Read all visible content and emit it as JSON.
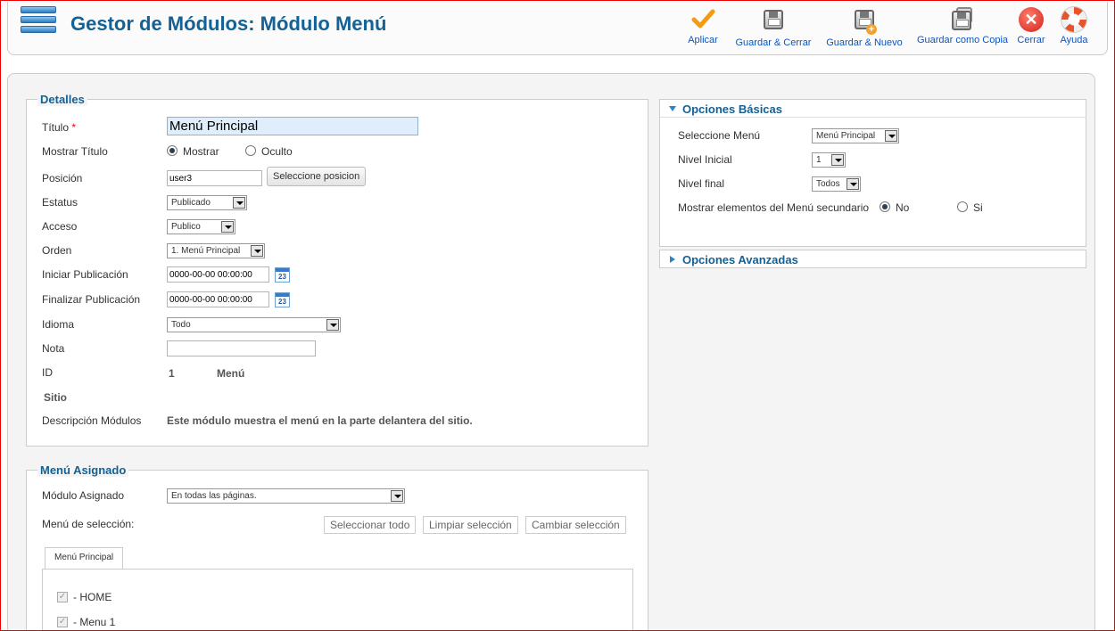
{
  "header": {
    "title": "Gestor de Módulos: Módulo Menú",
    "buttons": {
      "apply": "Aplicar",
      "save_close": "Guardar & Cerrar",
      "save_new": "Guardar & Nuevo",
      "save_copy": "Guardar como Copia",
      "close": "Cerrar",
      "help": "Ayuda"
    }
  },
  "details": {
    "legend": "Detalles",
    "title_label": "Título",
    "required_mark": "*",
    "title_value": "Menú Principal",
    "show_title_label": "Mostrar Título",
    "show_option": "Mostrar",
    "hide_option": "Oculto",
    "position_label": "Posición",
    "position_value": "user3",
    "position_button": "Seleccione posicion",
    "status_label": "Estatus",
    "status_value": "Publicado",
    "access_label": "Acceso",
    "access_value": "Publico",
    "order_label": "Orden",
    "order_value": "1. Menú Principal",
    "publish_up_label": "Iniciar Publicación",
    "publish_up_value": "0000-00-00 00:00:00",
    "publish_down_label": "Finalizar Publicación",
    "publish_down_value": "0000-00-00 00:00:00",
    "calendar_day": "23",
    "language_label": "Idioma",
    "language_value": "Todo",
    "note_label": "Nota",
    "note_value": "",
    "id_label": "ID",
    "id_value": "1",
    "module_type": "Menú",
    "site_label": "Sitio",
    "description_label": "Descripción Módulos",
    "description_value": "Este módulo muestra el menú en la parte delantera del sitio."
  },
  "assignment": {
    "legend": "Menú Asignado",
    "assigned_label": "Módulo Asignado",
    "assigned_value": "En todas las páginas.",
    "selection_label": "Menú de selección:",
    "select_all": "Seleccionar todo",
    "clear_selection": "Limpiar selección",
    "toggle_selection": "Cambiar selección",
    "tab": "Menú Principal",
    "items": [
      {
        "label": "- HOME",
        "checked": true
      },
      {
        "label": "- Menu 1",
        "checked": true
      }
    ]
  },
  "basic_options": {
    "title": "Opciones Básicas",
    "select_menu_label": "Seleccione Menú",
    "select_menu_value": "Menú Principal",
    "start_level_label": "Nivel Inicial",
    "start_level_value": "1",
    "end_level_label": "Nivel final",
    "end_level_value": "Todos",
    "show_sub_label": "Mostrar elementos del Menú secundario",
    "no_option": "No",
    "yes_option": "Si"
  },
  "advanced_options": {
    "title": "Opciones Avanzadas"
  }
}
